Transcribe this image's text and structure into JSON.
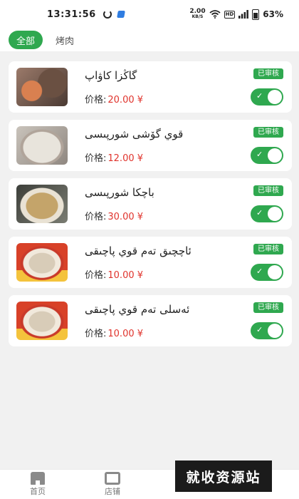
{
  "status_bar": {
    "time": "13:31:56",
    "net_speed": "2.00",
    "net_unit": "KB/S",
    "hd": "HD",
    "battery": "63%"
  },
  "tabs": [
    {
      "label": "全部",
      "active": true
    },
    {
      "label": "烤肉",
      "active": false
    }
  ],
  "items": [
    {
      "title": "گاڭزا كاۋاپ",
      "price_label": "价格:",
      "price": "20.00 ¥",
      "badge": "已审核",
      "enabled": true,
      "image": "grilled-meat"
    },
    {
      "title": "قوي گۆشى شورپىسى",
      "price_label": "价格:",
      "price": "12.00 ¥",
      "badge": "已审核",
      "enabled": true,
      "image": "lamb-soup"
    },
    {
      "title": "باچكا شورپىسى",
      "price_label": "价格:",
      "price": "30.00 ¥",
      "badge": "已审核",
      "enabled": true,
      "image": "offal-soup"
    },
    {
      "title": "ئاچچىق تەم قوي پاچىقى",
      "price_label": "价格:",
      "price": "10.00 ¥",
      "badge": "已审核",
      "enabled": true,
      "image": "spicy-trotter"
    },
    {
      "title": "ئەسلى تەم قوي پاچىقى",
      "price_label": "价格:",
      "price": "10.00 ¥",
      "badge": "已审核",
      "enabled": true,
      "image": "plain-trotter"
    }
  ],
  "bottom_nav": [
    {
      "label": "首页"
    },
    {
      "label": "店铺"
    }
  ],
  "watermark": "就收资源站",
  "colors": {
    "accent": "#2fa84f",
    "price": "#e0332c",
    "background": "#f1f1f1"
  }
}
